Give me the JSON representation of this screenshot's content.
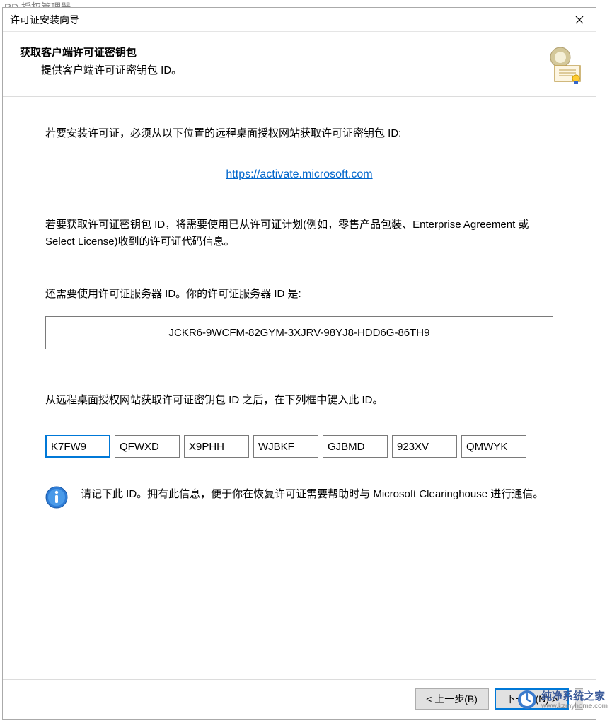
{
  "background_hint": "RD 授权管理器",
  "dialog": {
    "title": "许可证安装向导",
    "header_title": "获取客户端许可证密钥包",
    "header_subtitle": "提供客户端许可证密钥包 ID。",
    "instr1": "若要安装许可证，必须从以下位置的远程桌面授权网站获取许可证密钥包 ID:",
    "link_text": "https://activate.microsoft.com",
    "instr2": "若要获取许可证密钥包 ID，将需要使用已从许可证计划(例如，零售产品包装、Enterprise Agreement 或 Select License)收到的许可证代码信息。",
    "instr3": "还需要使用许可证服务器 ID。你的许可证服务器 ID 是:",
    "server_id": "JCKR6-9WCFM-82GYM-3XJRV-98YJ8-HDD6G-86TH9",
    "instr4": "从远程桌面授权网站获取许可证密钥包 ID 之后，在下列框中键入此 ID。",
    "key_parts": [
      "K7FW9",
      "QFWXD",
      "X9PHH",
      "WJBKF",
      "GJBMD",
      "923XV",
      "QMWYK"
    ],
    "info_text": "请记下此 ID。拥有此信息，便于你在恢复许可证需要帮助时与 Microsoft Clearinghouse 进行通信。",
    "buttons": {
      "back": "< 上一步(B)",
      "next": "下一页(N) >"
    }
  },
  "watermark": {
    "main": "纯净系统之家",
    "sub": "www.kzmyhome.com"
  }
}
